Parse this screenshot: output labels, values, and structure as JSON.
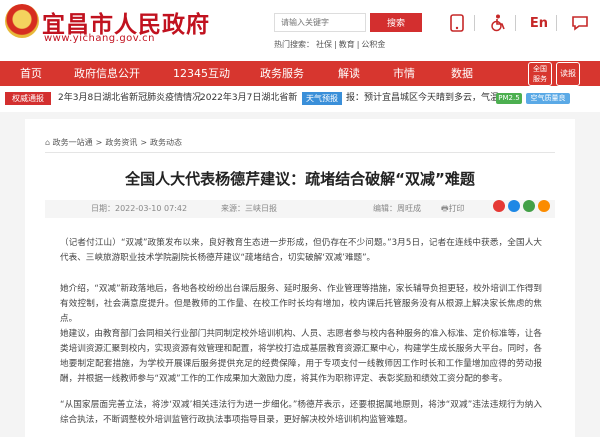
{
  "header": {
    "site_title": "宜昌市人民政府",
    "site_url": "www.yichang.gov.cn",
    "search_placeholder": "请输入关键字",
    "search_button": "搜索",
    "hot_words_label": "热门搜索：",
    "hot_words": [
      "社保",
      "教育",
      "公积金"
    ],
    "icons": [
      "tablet-icon",
      "wheelchair-icon",
      "english-icon",
      "chat-icon"
    ],
    "english_label": "En"
  },
  "nav": {
    "items": [
      "首页",
      "政府信息公开",
      "12345互动",
      "政务服务",
      "解读",
      "市情",
      "数据"
    ],
    "badges": [
      "全国\n服务",
      "读报"
    ]
  },
  "ticker": {
    "tag_left": "权威通报",
    "news": [
      "2年3月8日湖北省新冠肺炎疫情情况",
      "2022年3月7日湖北省新"
    ],
    "tag_right": "天气预报",
    "weather_text": "报：预计宜昌城区今天晴到多云，气温",
    "pm_label": "PM2.5",
    "aqi_label": "空气质量良"
  },
  "breadcrumb": [
    "政务一站通",
    "政务资讯",
    "政务动态"
  ],
  "article": {
    "title": "全国人大代表杨德芹建议：疏堵结合破解“双减”难题",
    "date": "日期：2022-03-10 07:42",
    "source": "来源：三峡日报",
    "editor": "编辑：周旺成",
    "print": "打印",
    "paragraphs": [
      "（记者付江山）“双减”政策发布以来，良好教育生态进一步形成，但仍存在不少问题。”3月5日，记者在连线中获悉，全国人大代表、三峡旅游职业技术学院副院长杨德芹建议“疏堵结合，切实破解‘双减’难题”。",
      "她介绍，“双减”新政落地后，各地各校纷纷出台课后服务、延时服务、作业管理等措施，家长辅导负担更轻，校外培训工作得到有效控制，社会满意度提升。但是教师的工作量、在校工作时长均有增加，校内课后托管服务没有从根源上解决家长焦虑的焦点。",
      "她建议，由教育部门会同相关行业部门共同制定校外培训机构、人员、志愿者参与校内各种服务的准入标准、定价标准等，让各类培训资源汇聚到校内，实现资源有效管理和配置，将学校打造成基层教育资源汇聚中心，构建学生成长服务大平台。同时，各地要制定配套措施，为学校开展课后服务提供充足的经费保障，用于专项支付一线教师因工作时长和工作量增加应得的劳动报酬，并根据一线教师参与“双减”工作的工作成果加大激励力度，将其作为职称评定、表彰奖励和绩效工资分配的参考。",
      "“从国家层面完善立法，将涉‘双减’相关违法行为进一步细化。”杨德芹表示，还要根据属地原则，将涉“双减”违法违规行为纳入综合执法，不断调整校外培训监管行政执法事项指导目录，更好解决校外培训机构监管难题。"
    ]
  },
  "colors": {
    "brand_red": "#d7362f",
    "weather_blue": "#3a8fd9",
    "share_icons": [
      "#e53935",
      "#1e88e5",
      "#43a047",
      "#fb8c00"
    ]
  }
}
